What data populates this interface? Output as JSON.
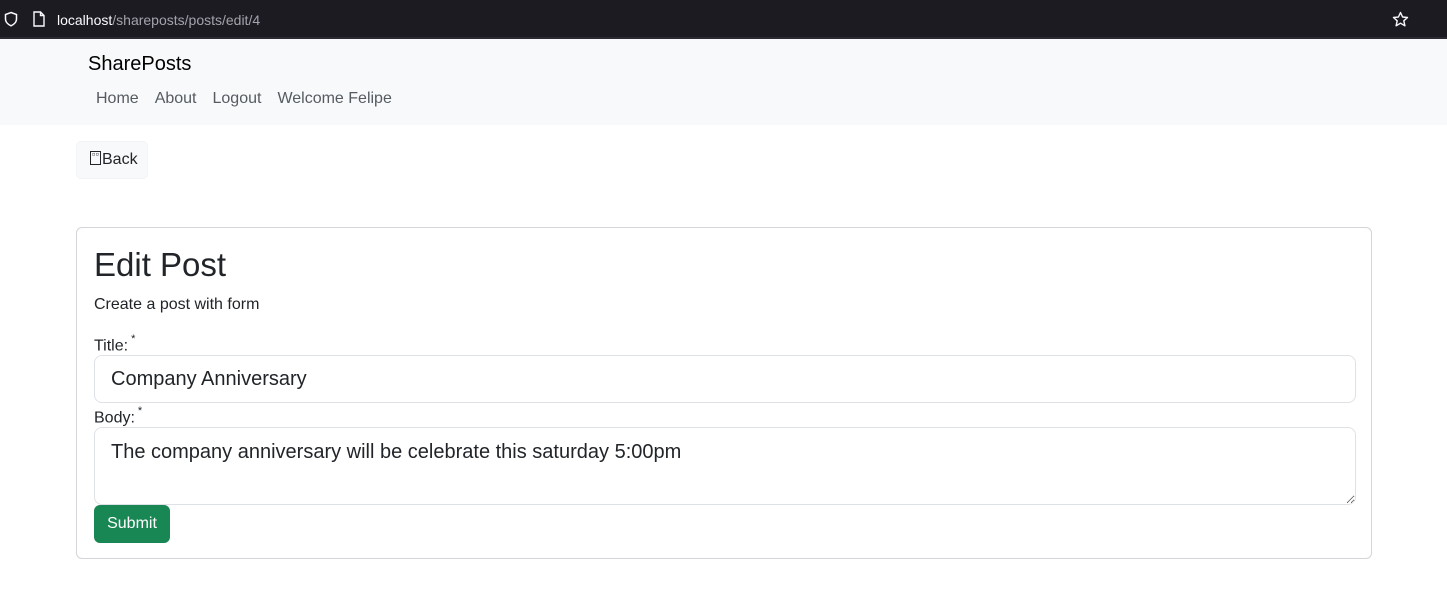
{
  "browser": {
    "url_host": "localhost",
    "url_path": "/shareposts/posts/edit/4"
  },
  "navbar": {
    "brand": "SharePosts",
    "links": [
      "Home",
      "About",
      "Logout",
      "Welcome Felipe"
    ]
  },
  "back_button": {
    "label": "Back"
  },
  "form": {
    "heading": "Edit Post",
    "subtitle": "Create a post with form",
    "title_label": "Title:",
    "body_label": "Body:",
    "required_mark": "*",
    "title_value": "Company Anniversary",
    "body_value": "The company anniversary will be celebrate this saturday 5:00pm",
    "submit_label": "Submit"
  },
  "colors": {
    "navbar_bg": "#f8f9fa",
    "submit_bg": "#198754",
    "browser_bar": "#1c1b22"
  },
  "icons": [
    "shield-icon",
    "page-icon",
    "star-icon",
    "back-arrow-icon"
  ]
}
